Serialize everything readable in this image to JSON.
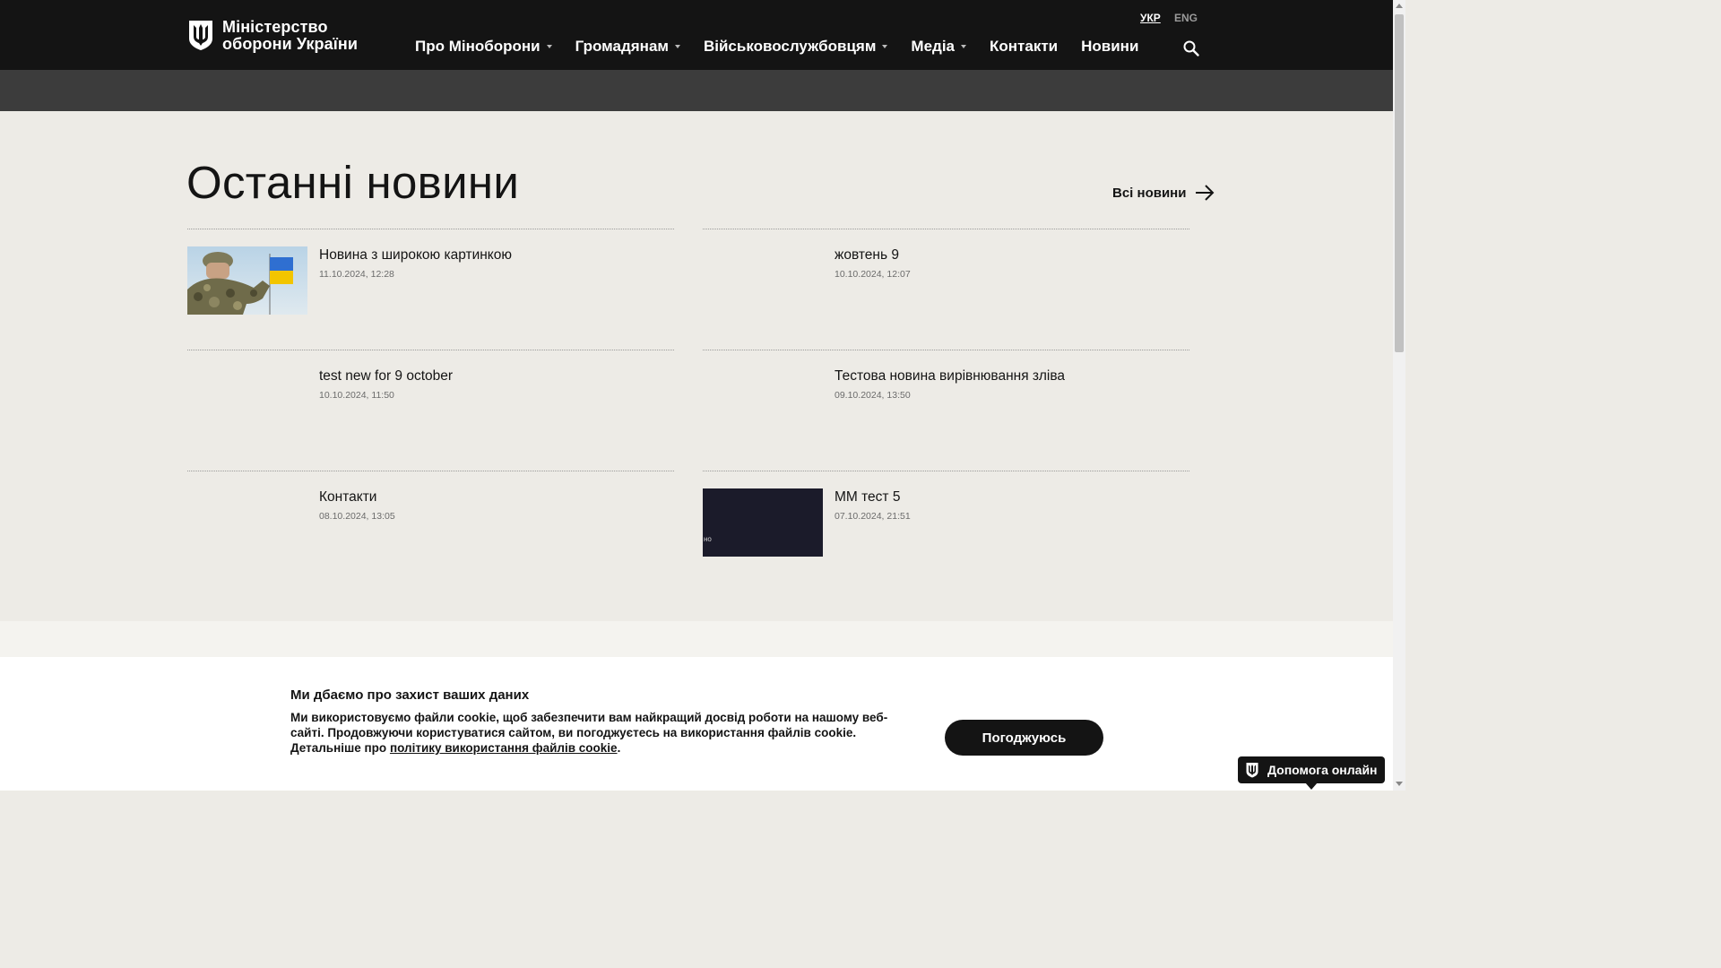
{
  "header": {
    "logo_line1": "Міністерство",
    "logo_line2": "оборони України",
    "lang_ukr": "УКР",
    "lang_eng": "ENG",
    "nav": [
      {
        "label": "Про Міноборони",
        "dropdown": true
      },
      {
        "label": "Громадянам",
        "dropdown": true
      },
      {
        "label": "Військовослужбовцям",
        "dropdown": true
      },
      {
        "label": "Медіа",
        "dropdown": true
      },
      {
        "label": "Контакти",
        "dropdown": false
      },
      {
        "label": "Новини",
        "dropdown": false
      }
    ],
    "search_icon": "search-icon"
  },
  "news": {
    "title": "Останні новини",
    "all_news_label": "Всі новини",
    "items": [
      {
        "title": "Новина з широкою картинкою",
        "date": "11.10.2024, 12:28",
        "thumb": "soldier-salute-flag"
      },
      {
        "title": "жовтень 9",
        "date": "10.10.2024, 12:07",
        "thumb": "none"
      },
      {
        "title": "test new for 9 october",
        "date": "10.10.2024, 11:50",
        "thumb": "none"
      },
      {
        "title": "Тестова новина вирівнювання зліва",
        "date": "09.10.2024, 13:50",
        "thumb": "none"
      },
      {
        "title": "Контакти",
        "date": "08.10.2024, 13:05",
        "thumb": "none"
      },
      {
        "title": "ММ тест 5",
        "date": "07.10.2024, 21:51",
        "thumb": "dark",
        "thumb_caption": "но"
      }
    ]
  },
  "cookie": {
    "title": "Ми дбаємо про захист ваших даних",
    "text": "Ми використовуємо файли cookie, щоб забезпечити вам найкращий досвід роботи на нашому веб-сайті. Продовжуючи користуватися сайтом, ви погоджуєтесь на використання файлів cookie. Детальніше про",
    "link": "політику використання файлів cookie",
    "text_end": ".",
    "button": "Погоджуюсь"
  },
  "help": {
    "label": "Допомога онлайн"
  },
  "colors": {
    "header_bg": "#141414",
    "subbar_bg": "#3c3c3c",
    "page_bg": "#edebe6",
    "accent_blue": "#2f6fd1",
    "accent_yellow": "#f2c500"
  }
}
